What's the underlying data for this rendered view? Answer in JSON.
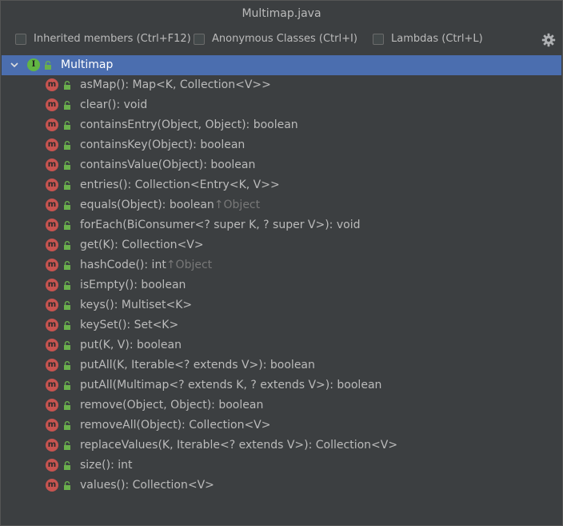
{
  "window": {
    "title": "Multimap.java"
  },
  "toolbar": {
    "inherited_label": "Inherited members (Ctrl+F12)",
    "anonymous_label": "Anonymous Classes (Ctrl+I)",
    "lambdas_label": "Lambdas (Ctrl+L)"
  },
  "tree": {
    "root_label": "Multimap",
    "methods": [
      {
        "label": "asMap(): Map<K, Collection<V>>",
        "inherited": ""
      },
      {
        "label": "clear(): void",
        "inherited": ""
      },
      {
        "label": "containsEntry(Object, Object): boolean",
        "inherited": ""
      },
      {
        "label": "containsKey(Object): boolean",
        "inherited": ""
      },
      {
        "label": "containsValue(Object): boolean",
        "inherited": ""
      },
      {
        "label": "entries(): Collection<Entry<K, V>>",
        "inherited": ""
      },
      {
        "label": "equals(Object): boolean",
        "inherited": "↑Object"
      },
      {
        "label": "forEach(BiConsumer<? super K, ? super V>): void",
        "inherited": ""
      },
      {
        "label": "get(K): Collection<V>",
        "inherited": ""
      },
      {
        "label": "hashCode(): int",
        "inherited": "↑Object"
      },
      {
        "label": "isEmpty(): boolean",
        "inherited": ""
      },
      {
        "label": "keys(): Multiset<K>",
        "inherited": ""
      },
      {
        "label": "keySet(): Set<K>",
        "inherited": ""
      },
      {
        "label": "put(K, V): boolean",
        "inherited": ""
      },
      {
        "label": "putAll(K, Iterable<? extends V>): boolean",
        "inherited": ""
      },
      {
        "label": "putAll(Multimap<? extends K, ? extends V>): boolean",
        "inherited": ""
      },
      {
        "label": "remove(Object, Object): boolean",
        "inherited": ""
      },
      {
        "label": "removeAll(Object): Collection<V>",
        "inherited": ""
      },
      {
        "label": "replaceValues(K, Iterable<? extends V>): Collection<V>",
        "inherited": ""
      },
      {
        "label": "size(): int",
        "inherited": ""
      },
      {
        "label": "values(): Collection<V>",
        "inherited": ""
      }
    ]
  },
  "icons": {
    "root": "interface-icon",
    "method": "method-icon",
    "lock": "public-lock-icon",
    "expand": "chevron-down-icon",
    "settings": "gear-icon"
  },
  "colors": {
    "background": "#3c3f41",
    "selection": "#4b6eaf",
    "method_icon": "#c75450",
    "interface_icon": "#62b543",
    "lock": "#6ab04c",
    "text": "#bbbbbb",
    "inherited_text": "#787878"
  }
}
